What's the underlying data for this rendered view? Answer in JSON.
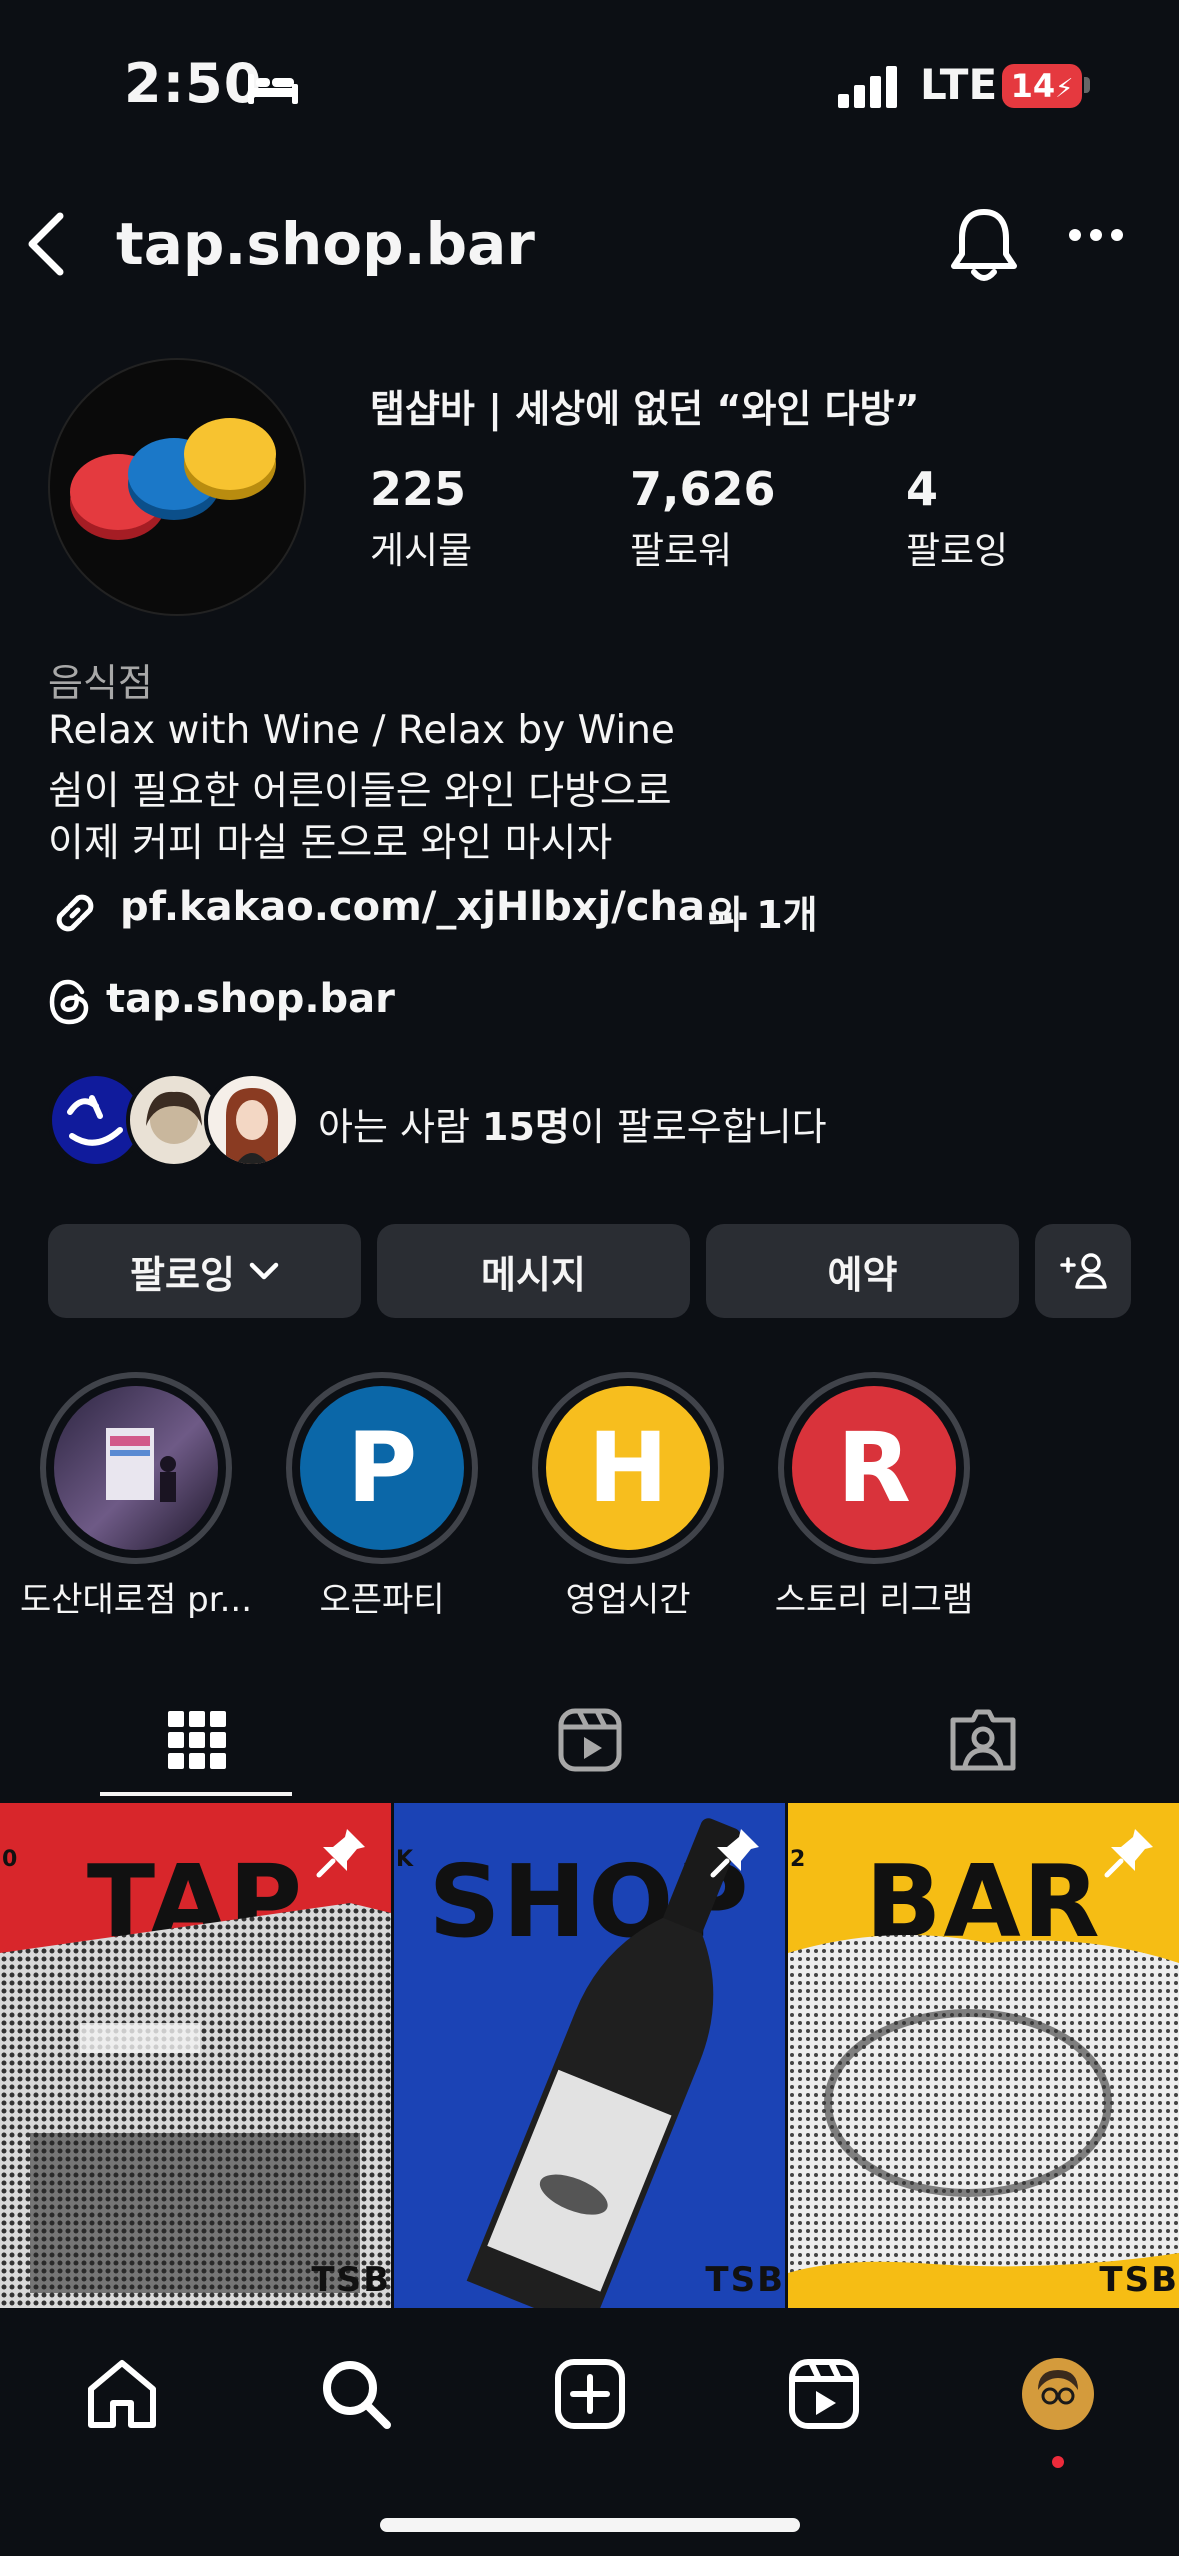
{
  "status_bar": {
    "time": "2:50",
    "network": "LTE",
    "battery": "14"
  },
  "header": {
    "username": "tap.shop.bar"
  },
  "profile": {
    "name": "탭샵바 | 세상에 없던 “와인 다방”",
    "stats": [
      {
        "value": "225",
        "label": "게시물"
      },
      {
        "value": "7,626",
        "label": "팔로워"
      },
      {
        "value": "4",
        "label": "팔로잉"
      }
    ],
    "category": "음식점",
    "bio": [
      "Relax with Wine / Relax by Wine",
      "쉼이 필요한 어른이들은 와인 다방으로",
      "이제 커피 마실 돈으로 와인 마시자"
    ],
    "link": "pf.kakao.com/_xjHlbxj/cha...",
    "link_extra": "외 1개",
    "threads": "tap.shop.bar",
    "followed_by_prefix": "아는 사람 ",
    "followed_by_count": "15명",
    "followed_by_suffix": "이 팔로우합니다"
  },
  "buttons": {
    "following": "팔로잉",
    "message": "메시지",
    "reserve": "예약"
  },
  "highlights": [
    {
      "label": "도산대로점 pr...",
      "letter": "",
      "color": "#5a4a6e"
    },
    {
      "label": "오픈파티",
      "letter": "P",
      "color": "#0b67a8"
    },
    {
      "label": "영업시간",
      "letter": "H",
      "color": "#f7be1e"
    },
    {
      "label": "스토리 리그램",
      "letter": "R",
      "color": "#d9333b"
    }
  ],
  "posts": [
    {
      "title": "TAP",
      "bg": "#d8262b",
      "num": "0"
    },
    {
      "title": "SHOP",
      "bg": "#1b43b5",
      "num": "K"
    },
    {
      "title": "BAR",
      "bg": "#f6bd14",
      "num": "2"
    }
  ],
  "posts_badge": "TSB",
  "colors": {
    "background": "#0c0f14",
    "button": "#2a2d33",
    "accent_red": "#ed2b3b"
  }
}
